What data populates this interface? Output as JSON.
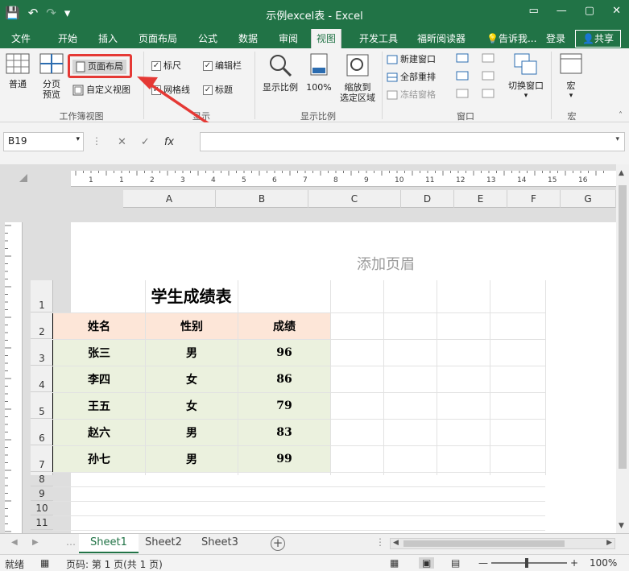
{
  "window": {
    "title": "示例excel表 - Excel"
  },
  "qat": {
    "save_icon": "💾",
    "undo_icon": "↶",
    "redo_icon": "↷",
    "customize_icon": "▾"
  },
  "controls": {
    "ribbon_opts": "▭",
    "minimize": "—",
    "restore": "▢",
    "close": "✕"
  },
  "tabs": [
    "文件",
    "开始",
    "插入",
    "页面布局",
    "公式",
    "数据",
    "审阅",
    "视图",
    "开发工具",
    "福昕阅读器"
  ],
  "active_tab": "视图",
  "tell_me": "告诉我...",
  "login": "登录",
  "share": "共享",
  "ribbon": {
    "workbook_views": {
      "label": "工作簿视图",
      "normal": "普通",
      "page_break_1": "分页",
      "page_break_2": "预览",
      "page_layout": "页面布局",
      "custom_views": "自定义视图"
    },
    "show": {
      "label": "显示",
      "ruler": "标尺",
      "formula_bar": "编辑栏",
      "gridlines": "网格线",
      "headings": "标题"
    },
    "zoom": {
      "label": "显示比例",
      "zoom": "显示比例",
      "zoom100": "100%",
      "zoom_sel_1": "缩放到",
      "zoom_sel_2": "选定区域"
    },
    "window": {
      "label": "窗口",
      "new_window": "新建窗口",
      "arrange_all": "全部重排",
      "freeze": "冻结窗格",
      "switch_1": "切换窗口"
    },
    "macros": {
      "label": "宏",
      "macros": "宏"
    }
  },
  "namebox": "B19",
  "fx_cancel": "✕",
  "fx_enter": "✓",
  "fx_label": "fx",
  "columns": [
    "A",
    "B",
    "C",
    "D",
    "E",
    "F",
    "G"
  ],
  "rows": [
    "1",
    "2",
    "3",
    "4",
    "5",
    "6",
    "7",
    "8",
    "9",
    "10",
    "11"
  ],
  "header_placeholder": "添加页眉",
  "sheet_title": "学生成绩表",
  "table": {
    "headers": [
      "姓名",
      "性别",
      "成绩"
    ],
    "rows": [
      [
        "张三",
        "男",
        "96"
      ],
      [
        "李四",
        "女",
        "86"
      ],
      [
        "王五",
        "女",
        "79"
      ],
      [
        "赵六",
        "男",
        "83"
      ],
      [
        "孙七",
        "男",
        "99"
      ]
    ]
  },
  "sheets": [
    "Sheet1",
    "Sheet2",
    "Sheet3"
  ],
  "active_sheet": "Sheet1",
  "add_sheet": "+",
  "status": {
    "ready": "就绪",
    "page": "页码: 第 1 页(共 1 页)",
    "zoom_minus": "—",
    "zoom_plus": "+",
    "zoom": "100%"
  },
  "colors": {
    "brand": "#217346",
    "annotation": "#e53935",
    "header_fill": "#fde6d8",
    "body_fill": "#ebf1de"
  },
  "ruler_numbers": [
    "1",
    "1",
    "2",
    "3",
    "4",
    "5",
    "6",
    "7",
    "8",
    "9",
    "10",
    "11",
    "12",
    "13",
    "14",
    "15",
    "16"
  ]
}
